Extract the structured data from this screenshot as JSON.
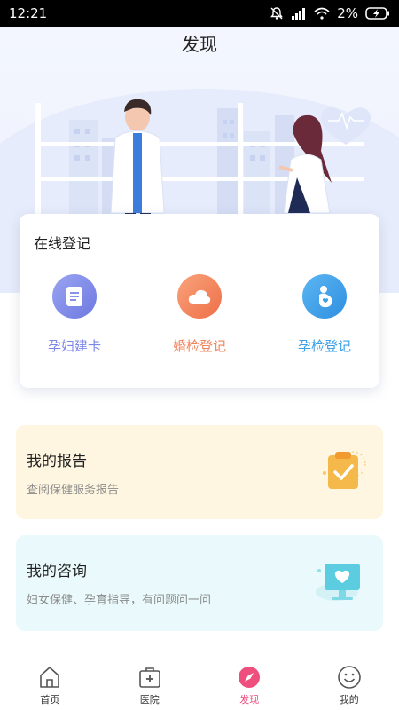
{
  "status_bar": {
    "time": "12:21",
    "battery": "2%"
  },
  "page": {
    "title": "发现"
  },
  "online_register": {
    "title": "在线登记",
    "items": [
      {
        "label": "孕妇建卡",
        "icon": "document-icon",
        "color": "#7b86e6"
      },
      {
        "label": "婚检登记",
        "icon": "cloud-icon",
        "color": "#f0845d"
      },
      {
        "label": "孕检登记",
        "icon": "pregnant-icon",
        "color": "#3b9fe6"
      }
    ]
  },
  "report_card": {
    "title": "我的报告",
    "subtitle": "查阅保健服务报告"
  },
  "consult_card": {
    "title": "我的咨询",
    "subtitle": "妇女保健、孕育指导，有问题问一问"
  },
  "tabbar": {
    "items": [
      {
        "label": "首页",
        "icon": "home-icon"
      },
      {
        "label": "医院",
        "icon": "hospital-icon"
      },
      {
        "label": "发现",
        "icon": "compass-icon",
        "active": true
      },
      {
        "label": "我的",
        "icon": "smiley-icon"
      }
    ]
  },
  "colors": {
    "accent": "#ef4f7d",
    "report_bg": "#fff6e2",
    "consult_bg": "#eafafc"
  }
}
